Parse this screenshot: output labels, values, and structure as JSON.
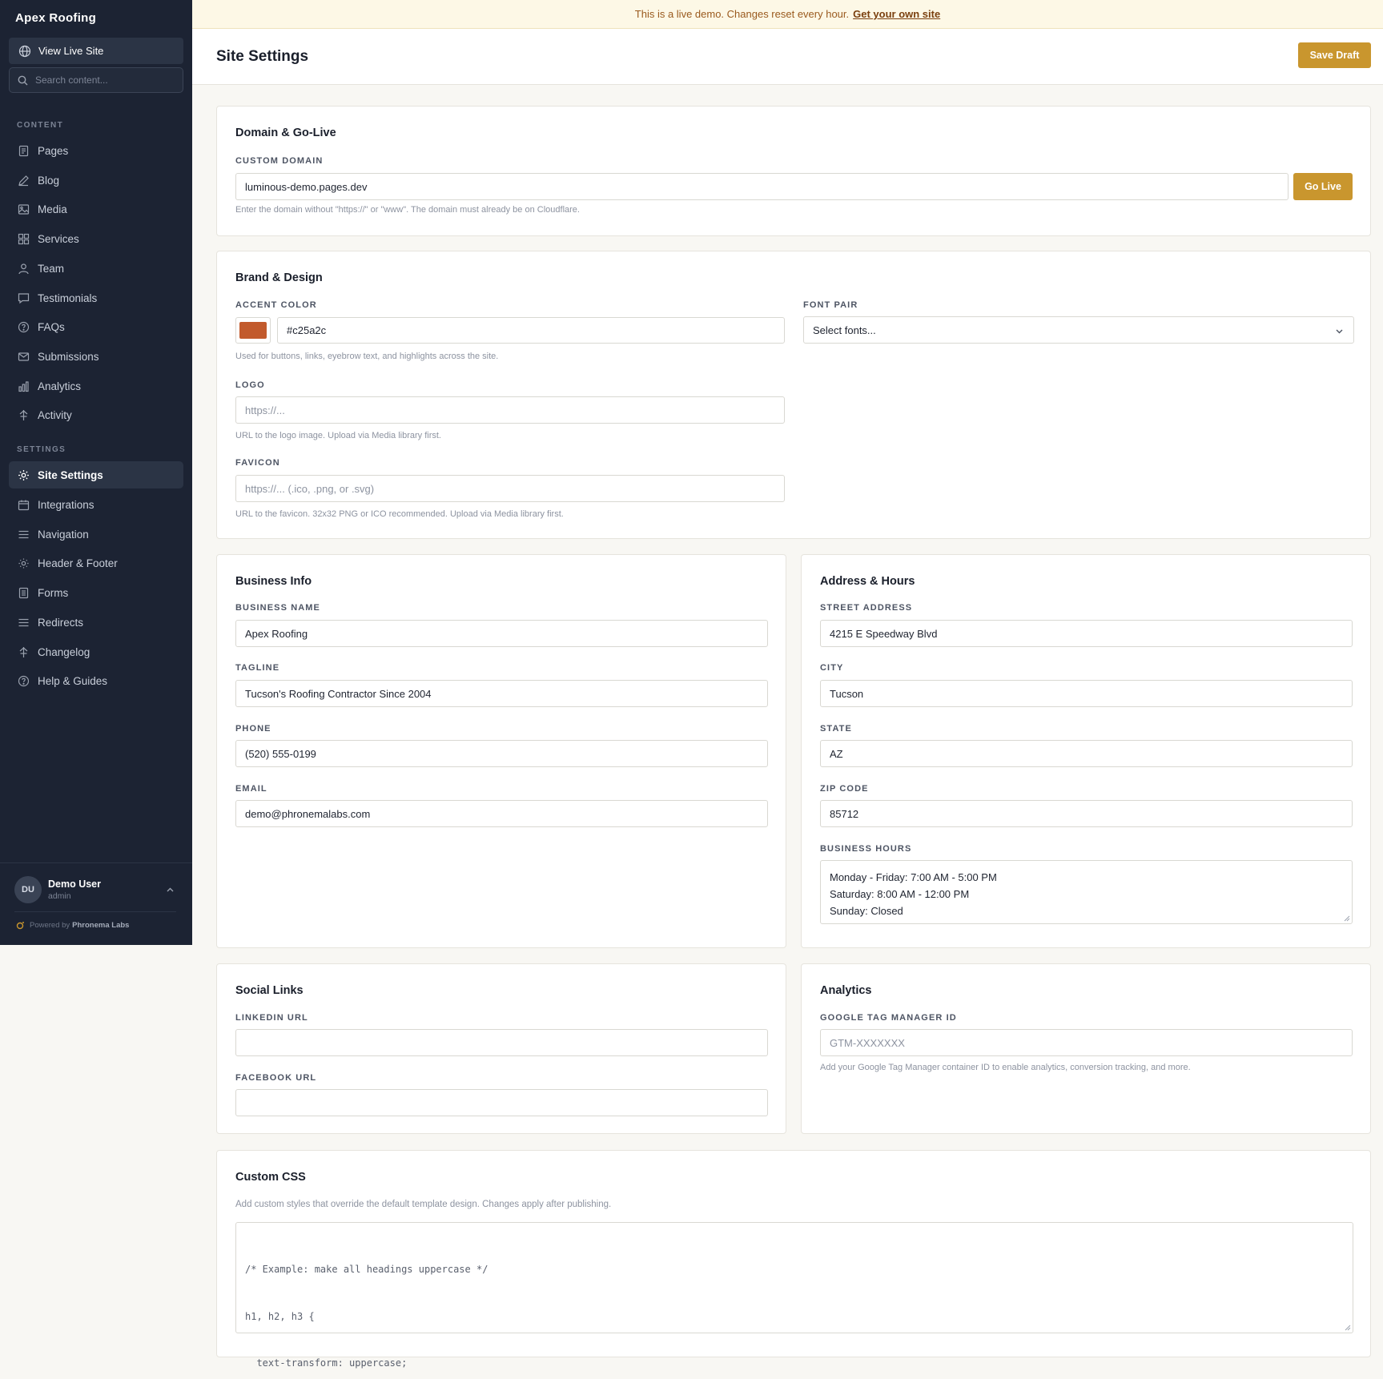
{
  "banner": {
    "message": "This is a live demo. Changes reset every hour.",
    "link": "Get your own site"
  },
  "sidebar": {
    "brand": "Apex Roofing",
    "view_live": "View Live Site",
    "search_placeholder": "Search content...",
    "content_label": "CONTENT",
    "content_items": [
      {
        "label": "Pages",
        "icon": "page-icon"
      },
      {
        "label": "Blog",
        "icon": "pen-icon"
      },
      {
        "label": "Media",
        "icon": "image-icon"
      },
      {
        "label": "Services",
        "icon": "grid-icon"
      },
      {
        "label": "Team",
        "icon": "user-icon"
      },
      {
        "label": "Testimonials",
        "icon": "chat-icon"
      },
      {
        "label": "FAQs",
        "icon": "question-icon"
      },
      {
        "label": "Submissions",
        "icon": "mail-icon"
      },
      {
        "label": "Analytics",
        "icon": "bar-chart-icon"
      },
      {
        "label": "Activity",
        "icon": "activity-icon"
      }
    ],
    "settings_label": "SETTINGS",
    "settings_items": [
      {
        "label": "Site Settings",
        "icon": "gear-icon",
        "active": true
      },
      {
        "label": "Integrations",
        "icon": "calendar-icon"
      },
      {
        "label": "Navigation",
        "icon": "menu-icon"
      },
      {
        "label": "Header & Footer",
        "icon": "sun-icon"
      },
      {
        "label": "Forms",
        "icon": "form-icon"
      },
      {
        "label": "Redirects",
        "icon": "menu-icon"
      },
      {
        "label": "Changelog",
        "icon": "activity-icon"
      },
      {
        "label": "Help & Guides",
        "icon": "question-icon"
      }
    ],
    "user": {
      "initials": "DU",
      "name": "Demo User",
      "role": "admin"
    },
    "powered_by": "Powered by",
    "powered_brand": "Phronema Labs"
  },
  "header": {
    "title": "Site Settings",
    "save_label": "Save Draft"
  },
  "domain": {
    "title": "Domain & Go-Live",
    "label": "CUSTOM DOMAIN",
    "value": "luminous-demo.pages.dev",
    "button": "Go Live",
    "help": "Enter the domain without \"https://\" or \"www\". The domain must already be on Cloudflare."
  },
  "brand": {
    "title": "Brand & Design",
    "accent_label": "ACCENT COLOR",
    "accent_value": "#c25a2c",
    "accent_help": "Used for buttons, links, eyebrow text, and highlights across the site.",
    "font_label": "FONT PAIR",
    "font_value": "Select fonts...",
    "logo_label": "LOGO",
    "logo_placeholder": "https://...",
    "logo_help": "URL to the logo image. Upload via Media library first.",
    "favicon_label": "FAVICON",
    "favicon_placeholder": "https://... (.ico, .png, or .svg)",
    "favicon_help": "URL to the favicon. 32x32 PNG or ICO recommended. Upload via Media library first."
  },
  "business": {
    "title": "Business Info",
    "name_label": "BUSINESS NAME",
    "name_value": "Apex Roofing",
    "tagline_label": "TAGLINE",
    "tagline_value": "Tucson's Roofing Contractor Since 2004",
    "phone_label": "PHONE",
    "phone_value": "(520) 555-0199",
    "email_label": "EMAIL",
    "email_value": "demo@phronemalabs.com"
  },
  "address": {
    "title": "Address & Hours",
    "street_label": "STREET ADDRESS",
    "street_value": "4215 E Speedway Blvd",
    "city_label": "CITY",
    "city_value": "Tucson",
    "state_label": "STATE",
    "state_value": "AZ",
    "zip_label": "ZIP CODE",
    "zip_value": "85712",
    "hours_label": "BUSINESS HOURS",
    "hours_lines": [
      "Monday - Friday: 7:00 AM - 5:00 PM",
      "Saturday: 8:00 AM - 12:00 PM",
      "Sunday: Closed"
    ]
  },
  "social": {
    "title": "Social Links",
    "linkedin_label": "LINKEDIN URL",
    "linkedin_value": "",
    "facebook_label": "FACEBOOK URL",
    "facebook_value": ""
  },
  "analytics": {
    "title": "Analytics",
    "gtm_label": "GOOGLE TAG MANAGER ID",
    "gtm_placeholder": "GTM-XXXXXXX",
    "gtm_help": "Add your Google Tag Manager container ID to enable analytics, conversion tracking, and more."
  },
  "css": {
    "title": "Custom CSS",
    "help": "Add custom styles that override the default template design. Changes apply after publishing.",
    "lines": [
      "/* Example: make all headings uppercase */",
      "h1, h2, h3 {",
      "  text-transform: uppercase;",
      "}"
    ]
  },
  "colors": {
    "sidebar_bg": "#1c2333",
    "gold": "#c9962e",
    "accent": "#c25a2c",
    "banner_bg": "#fdf8e6"
  }
}
